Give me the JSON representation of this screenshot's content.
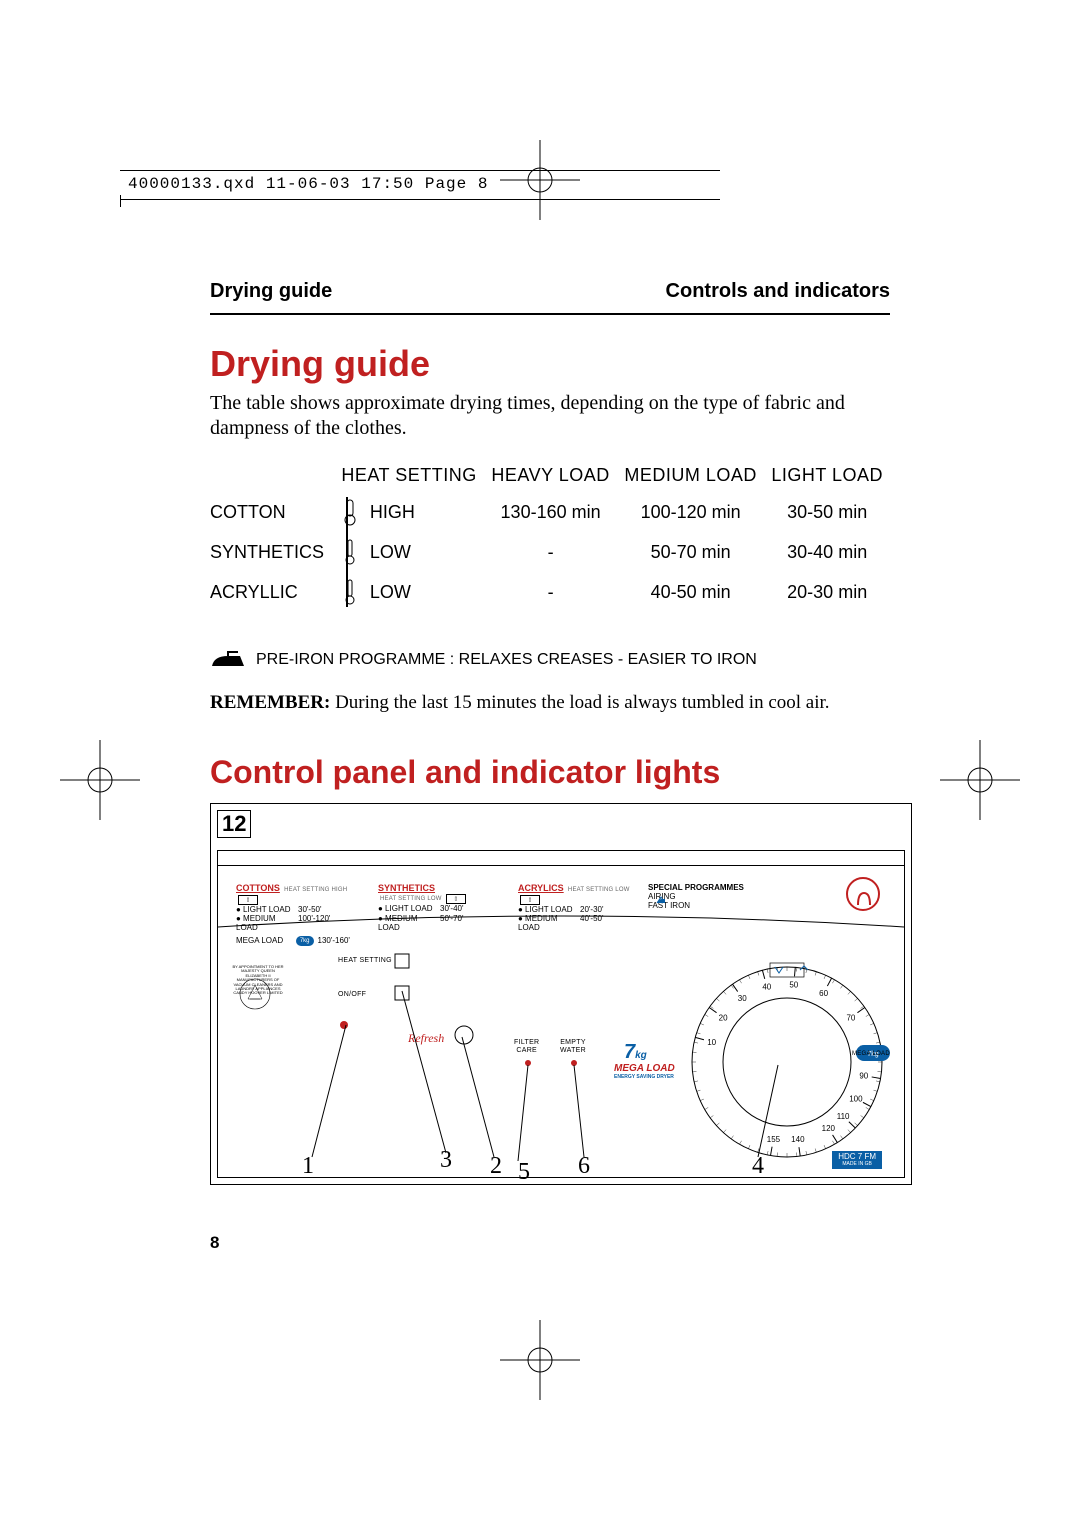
{
  "slug": "40000133.qxd  11-06-03  17:50  Page 8",
  "running_heads": {
    "left": "Drying guide",
    "right": "Controls and indicators"
  },
  "h1": "Drying guide",
  "intro": "The table shows approximate drying times, depending on the type of fabric and dampness of the clothes.",
  "table": {
    "headers": [
      "",
      "HEAT SETTING",
      "HEAVY LOAD",
      "MEDIUM LOAD",
      "LIGHT LOAD"
    ],
    "rows": [
      {
        "fabric": "COTTON",
        "heat": "HIGH",
        "heavy": "130-160 min",
        "medium": "100-120 min",
        "light": "30-50 min"
      },
      {
        "fabric": "SYNTHETICS",
        "heat": "LOW",
        "heavy": "-",
        "medium": "50-70 min",
        "light": "30-40 min"
      },
      {
        "fabric": "ACRYLLIC",
        "heat": "LOW",
        "heavy": "-",
        "medium": "40-50 min",
        "light": "20-30 min"
      }
    ]
  },
  "preiron_note": "PRE-IRON PROGRAMME :  RELAXES CREASES - EASIER TO IRON",
  "remember_label": "REMEMBER:",
  "remember_text": " During the last 15 minutes the load is always tumbled in cool air.",
  "h2": "Control panel and indicator lights",
  "figure_label": "12",
  "fascia": {
    "cottons": {
      "title": "COTTONS",
      "sub": "HEAT SETTING HIGH",
      "rows": [
        {
          "lbl": "● LIGHT LOAD",
          "val": "30'-50'"
        },
        {
          "lbl": "● MEDIUM LOAD",
          "val": "100'-120'"
        }
      ],
      "mega": {
        "label": "MEGA LOAD",
        "badge": "7kg",
        "val": "130'-160'"
      }
    },
    "synthetics": {
      "title": "SYNTHETICS",
      "sub": "HEAT SETTING LOW",
      "rows": [
        {
          "lbl": "● LIGHT LOAD",
          "val": "30'-40'"
        },
        {
          "lbl": "● MEDIUM LOAD",
          "val": "50'-70'"
        }
      ]
    },
    "acrylics": {
      "title": "ACRYLICS",
      "sub": "HEAT SETTING LOW",
      "rows": [
        {
          "lbl": "● LIGHT LOAD",
          "val": "20'-30'"
        },
        {
          "lbl": "● MEDIUM LOAD",
          "val": "40'-50'"
        }
      ]
    },
    "special": {
      "title": "SPECIAL PROGRAMMES",
      "items": [
        {
          "lbl": "AIRING"
        },
        {
          "lbl": "FAST IRON"
        }
      ]
    },
    "labels": {
      "heat_setting": "HEAT SETTING",
      "on_off": "ON/OFF",
      "refresh": "Refresh",
      "filter_care": "FILTER\nCARE",
      "empty_water": "EMPTY\nWATER",
      "seven": "7",
      "kg": "kg",
      "mega_load": "MEGA LOAD",
      "mega_sub": "ENERGY SAVING DRYER",
      "hdc_line1": "HDC 7 FM",
      "hdc_line2": "MADE IN GB",
      "dial_marks": [
        "10",
        "20",
        "30",
        "40",
        "50",
        "60",
        "70",
        "80",
        "90",
        "100",
        "110",
        "120",
        "140",
        "155"
      ],
      "mega_dial": "MEGA LOAD"
    },
    "seal": "BY APPOINTMENT TO HER MAJESTY QUEEN ELIZABETH II MANUFACTURERS OF VACUUM CLEANERS AND LAUNDRY APPLIANCES CANDY HOOVER LIMITED"
  },
  "callouts": [
    "1",
    "2",
    "3",
    "4",
    "5",
    "6"
  ],
  "page_number": "8"
}
